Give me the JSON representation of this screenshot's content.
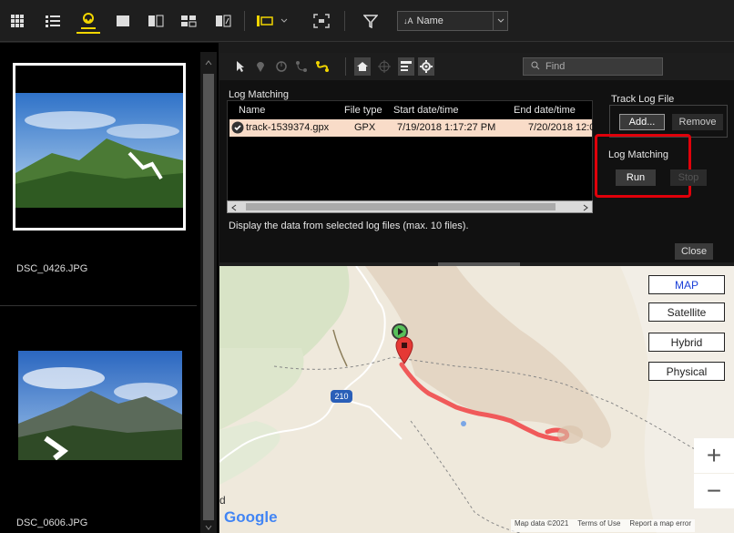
{
  "toolbar": {
    "sort_label": "Name"
  },
  "left_pane": {
    "thumbnails": [
      {
        "filename": "DSC_0426.JPG"
      },
      {
        "filename": "DSC_0606.JPG"
      }
    ]
  },
  "panel": {
    "find_placeholder": "Find",
    "log_matching_title": "Log Matching",
    "table": {
      "columns": [
        "Name",
        "File type",
        "Start date/time",
        "End date/time"
      ],
      "rows": [
        {
          "name": "track-1539374.gpx",
          "type": "GPX",
          "start": "7/19/2018 1:17:27 PM",
          "end": "7/20/2018 12:0"
        }
      ]
    },
    "description": "Display the data from selected log files (max. 10 files).",
    "track_log_file": {
      "title": "Track Log File",
      "add_label": "Add...",
      "remove_label": "Remove"
    },
    "log_matching_box": {
      "title": "Log Matching",
      "run_label": "Run",
      "stop_label": "Stop"
    },
    "close_label": "Close"
  },
  "map": {
    "type_buttons": [
      "MAP",
      "Satellite",
      "Hybrid",
      "Physical"
    ],
    "active_type": "MAP",
    "road_label": "210",
    "zoom_in": "+",
    "zoom_out": "−",
    "logo": "Google",
    "footer": {
      "map_data": "Map data ©2021",
      "terms": "Terms of Use",
      "report": "Report a map error"
    },
    "edge_glyph": "d"
  },
  "colors": {
    "highlight_box": "#e0000a",
    "selected_row": "#f9dcc8",
    "track": "#f05a5a",
    "active_toolbar": "#f2d600"
  }
}
